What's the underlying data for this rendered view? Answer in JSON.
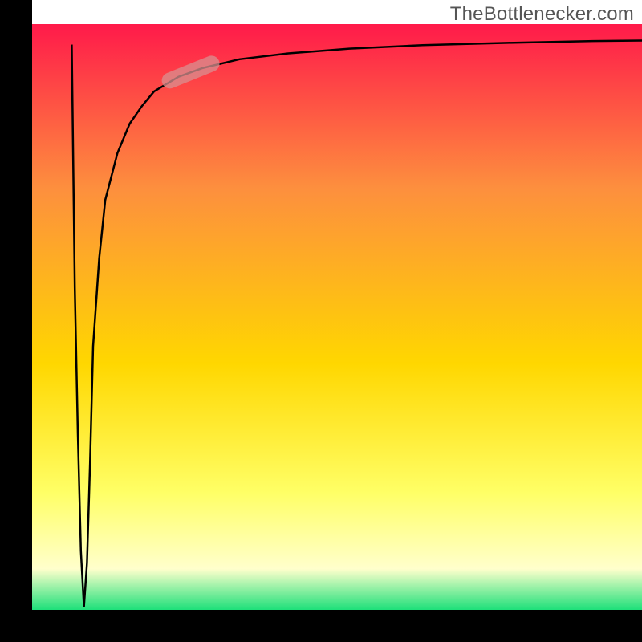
{
  "watermark": "TheBottlenecker.com",
  "chart_data": {
    "type": "line",
    "title": "",
    "xlabel": "",
    "ylabel": "",
    "xlim": [
      0,
      100
    ],
    "ylim": [
      0,
      100
    ],
    "background_gradient": {
      "top_color": "#ff1a4a",
      "mid_top_color": "#fd8f3e",
      "mid_color": "#ffd700",
      "mid_low_color": "#ffff66",
      "low_pale_color": "#ffffcc",
      "bottom_color": "#1ee07a"
    },
    "axis_color": "#000000",
    "series": [
      {
        "name": "curve",
        "color": "#000000",
        "x": [
          6.5,
          7.0,
          7.5,
          8.0,
          8.5,
          9.0,
          9.5,
          10,
          11,
          12,
          14,
          16,
          18,
          20,
          24,
          28,
          34,
          42,
          52,
          64,
          78,
          92,
          100
        ],
        "y": [
          96.5,
          55,
          30,
          10,
          0.5,
          8,
          25,
          45,
          60,
          70,
          78,
          83,
          86,
          88.5,
          91,
          92.5,
          94,
          95,
          95.8,
          96.4,
          96.8,
          97.1,
          97.2
        ]
      }
    ],
    "highlight": {
      "name": "oval-highlight",
      "center_x": 26,
      "center_y": 91.8,
      "length": 10,
      "angle_deg": -22,
      "color": "#d89090",
      "opacity": 0.75
    },
    "axes": {
      "x_axis_y": 0,
      "y_axis_x": 5,
      "left_border_x": 0
    }
  }
}
